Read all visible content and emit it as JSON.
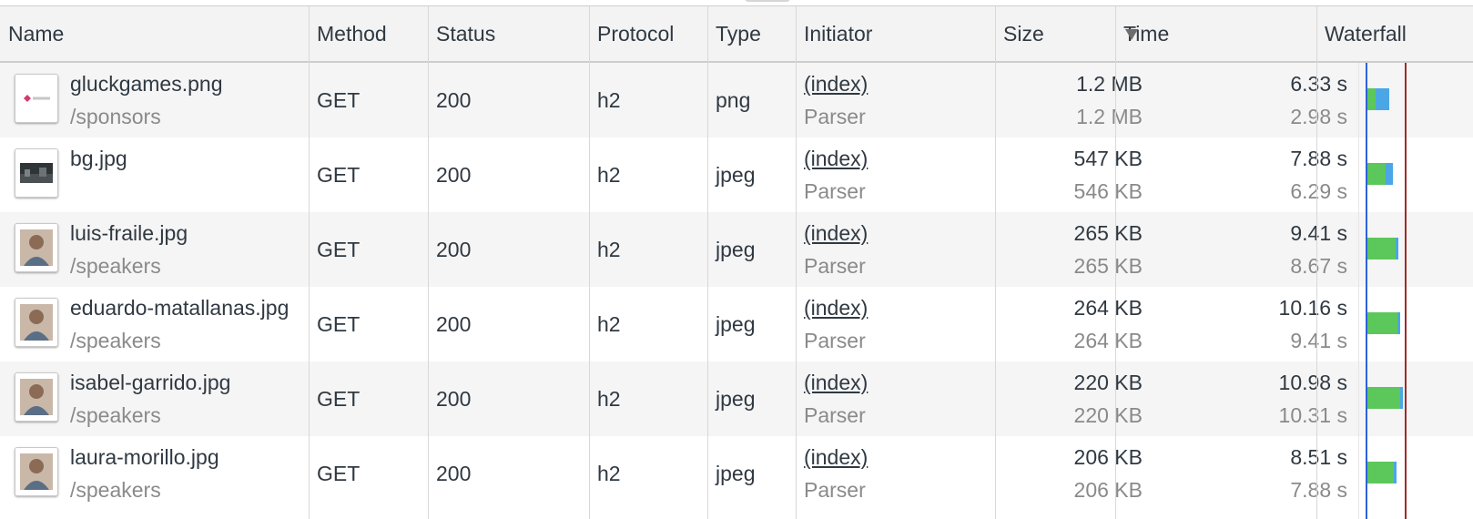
{
  "columns": {
    "name": "Name",
    "method": "Method",
    "status": "Status",
    "protocol": "Protocol",
    "type": "Type",
    "initiator": "Initiator",
    "size": "Size",
    "time": "Time",
    "waterfall": "Waterfall"
  },
  "sort": {
    "column": "Size",
    "direction": "descending",
    "icon": "sort-descending-icon"
  },
  "rows": [
    {
      "name": "gluckgames.png",
      "path": "/sponsors",
      "method": "GET",
      "status": "200",
      "protocol": "h2",
      "type": "png",
      "initiator": "(index)",
      "initiator_type": "Parser",
      "size_transferred": "1.2 MB",
      "size_resource": "1.2 MB",
      "time_total": "6.33 s",
      "time_latency": "2.98 s",
      "thumbnail": "sponsor-logo"
    },
    {
      "name": "bg.jpg",
      "path": "",
      "method": "GET",
      "status": "200",
      "protocol": "h2",
      "type": "jpeg",
      "initiator": "(index)",
      "initiator_type": "Parser",
      "size_transferred": "547 KB",
      "size_resource": "546 KB",
      "time_total": "7.88 s",
      "time_latency": "6.29 s",
      "thumbnail": "background-photo"
    },
    {
      "name": "luis-fraile.jpg",
      "path": "/speakers",
      "method": "GET",
      "status": "200",
      "protocol": "h2",
      "type": "jpeg",
      "initiator": "(index)",
      "initiator_type": "Parser",
      "size_transferred": "265 KB",
      "size_resource": "265 KB",
      "time_total": "9.41 s",
      "time_latency": "8.67 s",
      "thumbnail": "speaker-photo"
    },
    {
      "name": "eduardo-matallanas.jpg",
      "path": "/speakers",
      "method": "GET",
      "status": "200",
      "protocol": "h2",
      "type": "jpeg",
      "initiator": "(index)",
      "initiator_type": "Parser",
      "size_transferred": "264 KB",
      "size_resource": "264 KB",
      "time_total": "10.16 s",
      "time_latency": "9.41 s",
      "thumbnail": "speaker-photo"
    },
    {
      "name": "isabel-garrido.jpg",
      "path": "/speakers",
      "method": "GET",
      "status": "200",
      "protocol": "h2",
      "type": "jpeg",
      "initiator": "(index)",
      "initiator_type": "Parser",
      "size_transferred": "220 KB",
      "size_resource": "220 KB",
      "time_total": "10.98 s",
      "time_latency": "10.31 s",
      "thumbnail": "speaker-photo"
    },
    {
      "name": "laura-morillo.jpg",
      "path": "/speakers",
      "method": "GET",
      "status": "200",
      "protocol": "h2",
      "type": "jpeg",
      "initiator": "(index)",
      "initiator_type": "Parser",
      "size_transferred": "206 KB",
      "size_resource": "206 KB",
      "time_total": "8.51 s",
      "time_latency": "7.88 s",
      "thumbnail": "speaker-photo"
    }
  ],
  "colors": {
    "waterfall_waiting": "#5cc75a",
    "waterfall_download": "#4ba6e6",
    "dom_content_loaded_line": "#2b62d9",
    "load_line": "#9e2b27"
  }
}
